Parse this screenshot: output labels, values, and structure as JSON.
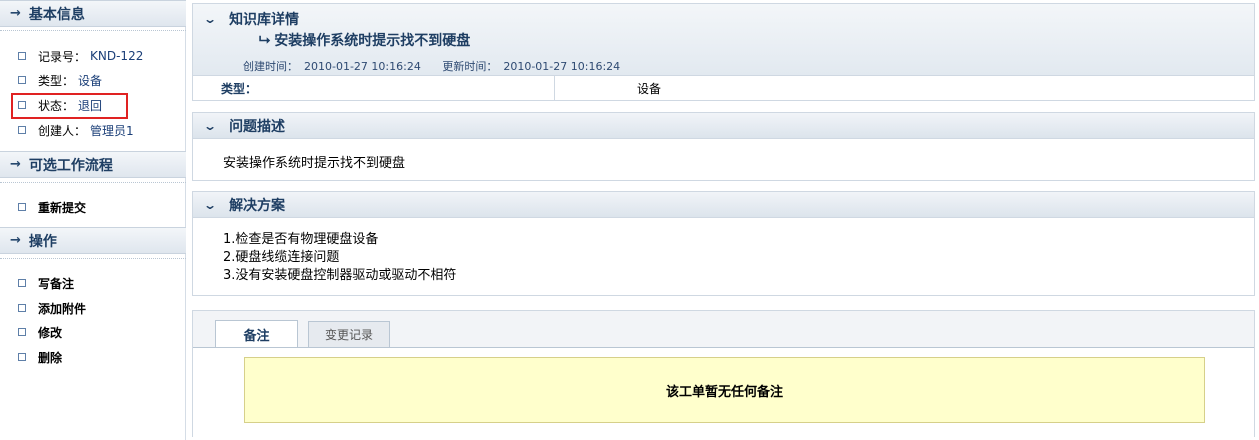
{
  "sidebar": {
    "basic_info": {
      "title": "基本信息",
      "items": [
        {
          "label": "记录号：",
          "value": "KND-122"
        },
        {
          "label": "类型：",
          "value": "设备"
        },
        {
          "label": "状态：",
          "value": "退回"
        },
        {
          "label": "创建人：",
          "value": "管理员1"
        }
      ]
    },
    "workflow": {
      "title": "可选工作流程",
      "items": [
        {
          "label": "重新提交"
        }
      ]
    },
    "operations": {
      "title": "操作",
      "items": [
        {
          "label": "写备注"
        },
        {
          "label": "添加附件"
        },
        {
          "label": "修改"
        },
        {
          "label": "删除"
        }
      ]
    }
  },
  "detail": {
    "header": "知识库详情",
    "subject": "安装操作系统时提示找不到硬盘",
    "created_label": "创建时间：",
    "created_value": "2010-01-27 10:16:24",
    "updated_label": "更新时间：",
    "updated_value": "2010-01-27 10:16:24",
    "type_label": "类型：",
    "type_value": "设备"
  },
  "problem": {
    "header": "问题描述",
    "text": "安装操作系统时提示找不到硬盘"
  },
  "solution": {
    "header": "解决方案",
    "lines": [
      "1.检查是否有物理硬盘设备",
      "2.硬盘线缆连接问题",
      "3.没有安装硬盘控制器驱动或驱动不相符"
    ]
  },
  "notes": {
    "tabs": [
      {
        "label": "备注",
        "active": true
      },
      {
        "label": "变更记录",
        "active": false
      }
    ],
    "empty_message": "该工单暂无任何备注"
  },
  "colors": {
    "accent": "#1e3e63",
    "link": "#1b3f78",
    "highlight_border": "#e02222",
    "notes_bg": "#ffffcc"
  }
}
